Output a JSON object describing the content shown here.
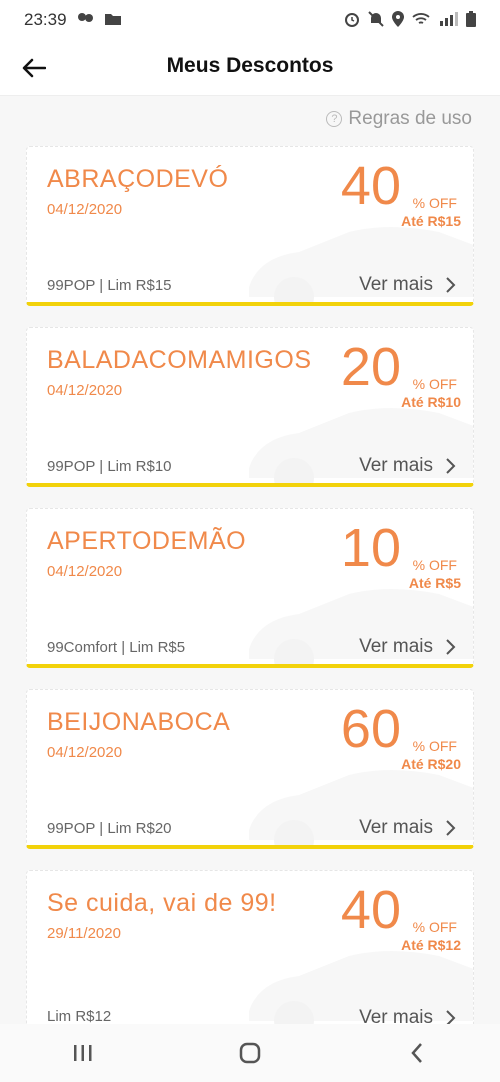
{
  "status": {
    "time": "23:39"
  },
  "header": {
    "title": "Meus Descontos"
  },
  "rules": {
    "label": "Regras de uso"
  },
  "coupons": [
    {
      "code": "ABRAÇODEVÓ",
      "date": "04/12/2020",
      "percent": "40",
      "off_label": "% OFF",
      "limit_label": "Até R$15",
      "footer": "99POP | Lim R$15",
      "more_label": "Ver mais"
    },
    {
      "code": "BALADACOMAMIGOS",
      "date": "04/12/2020",
      "percent": "20",
      "off_label": "% OFF",
      "limit_label": "Até R$10",
      "footer": "99POP | Lim R$10",
      "more_label": "Ver mais"
    },
    {
      "code": "APERTODEMÃO",
      "date": "04/12/2020",
      "percent": "10",
      "off_label": "% OFF",
      "limit_label": "Até R$5",
      "footer": "99Comfort | Lim R$5",
      "more_label": "Ver mais"
    },
    {
      "code": "BEIJONABOCA",
      "date": "04/12/2020",
      "percent": "60",
      "off_label": "% OFF",
      "limit_label": "Até R$20",
      "footer": "99POP | Lim R$20",
      "more_label": "Ver mais"
    },
    {
      "code": "Se cuida, vai de 99!",
      "date": "29/11/2020",
      "percent": "40",
      "off_label": "% OFF",
      "limit_label": "Até R$12",
      "footer": "Lim R$12",
      "more_label": "Ver mais"
    }
  ],
  "colors": {
    "accent": "#f0894a",
    "highlight": "#f2d20a"
  }
}
